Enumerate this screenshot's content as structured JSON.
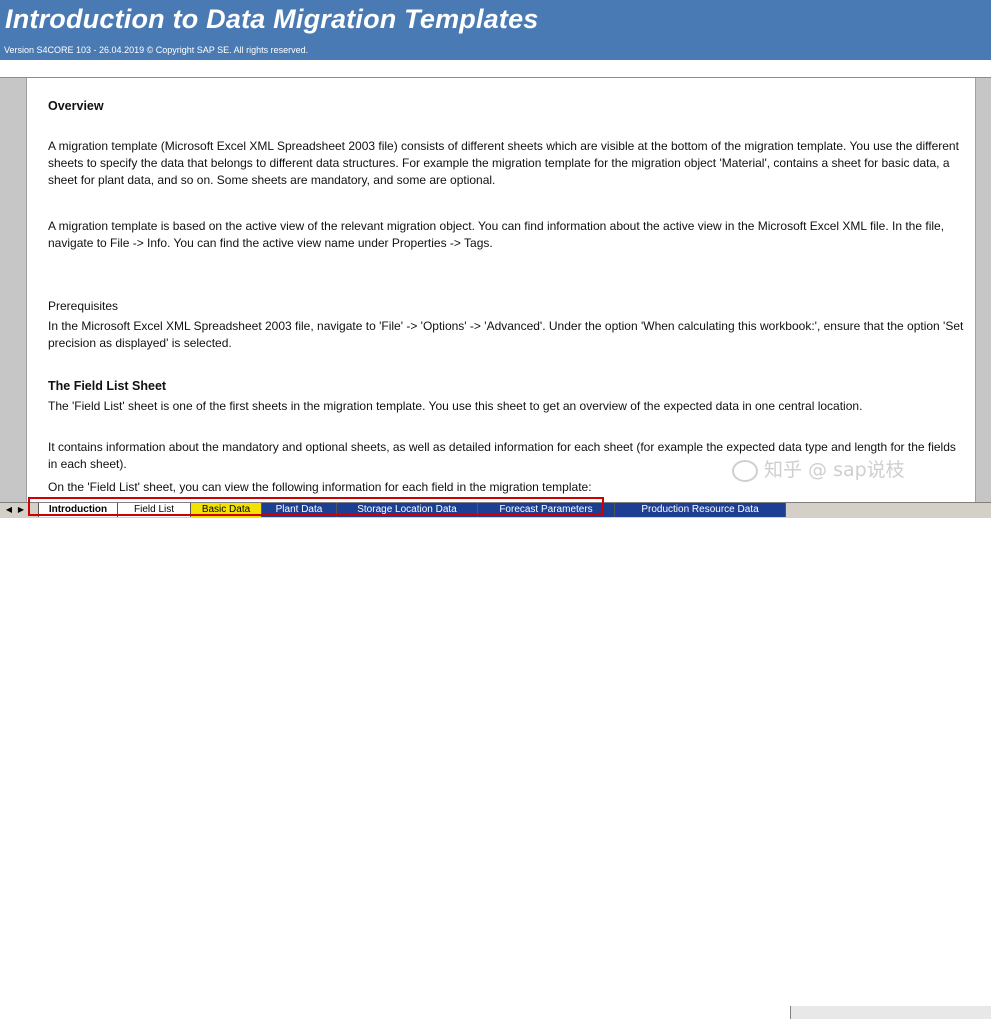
{
  "banner": {
    "title": "Introduction to Data Migration Templates",
    "version": "Version S4CORE 103 - 26.04.2019 © Copyright SAP SE. All rights reserved."
  },
  "content": {
    "overview_heading": "Overview",
    "para1": "A migration template (Microsoft Excel XML Spreadsheet 2003 file) consists of different sheets which are visible at the bottom of the migration template. You use the different sheets to specify the data that belongs to different data structures. For example the migration template for the migration object 'Material', contains a sheet for basic data, a sheet for plant data, and so on. Some sheets are mandatory, and some are optional.",
    "para2": "A migration template is based on the active view of the relevant migration object. You can find information about the active view in the Microsoft Excel XML file. In the file, navigate to File -> Info. You can find the active view name under Properties -> Tags.",
    "prereq_label": "Prerequisites",
    "para3": "In the Microsoft Excel XML Spreadsheet 2003 file, navigate to 'File' -> 'Options' -> 'Advanced'. Under the option 'When calculating this workbook:', ensure that the option 'Set precision as displayed' is selected.",
    "field_list_heading": "The Field List Sheet",
    "para4": "The 'Field List' sheet is one of the first sheets in the migration template. You use this sheet to get an overview of the expected data in one central location.",
    "para5": "It contains information about the mandatory and optional sheets, as well as detailed information for each sheet (for example the expected data type and length for the fields in each sheet).",
    "para6": "On the 'Field List' sheet, you can view the following information for each field in the migration template:"
  },
  "watermark": "知乎 @ sap说枝",
  "sheet_tabs": [
    {
      "label": "Introduction"
    },
    {
      "label": "Field List"
    },
    {
      "label": "Basic Data"
    },
    {
      "label": "Plant Data"
    },
    {
      "label": "Storage Location Data"
    },
    {
      "label": "Forecast Parameters"
    },
    {
      "label": "Production Resource Data"
    }
  ],
  "tab_colors": {
    "active": "#ffffff",
    "mandatory": "#f3e100",
    "optional": "#1c3f94"
  }
}
